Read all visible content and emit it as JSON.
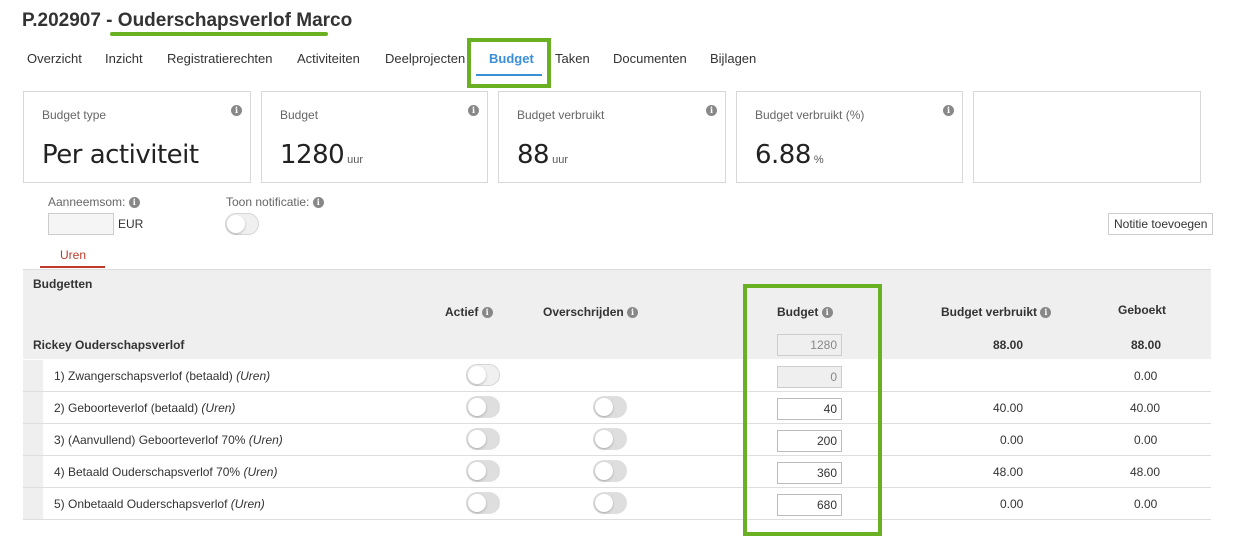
{
  "project": {
    "title": "P.202907 - Ouderschapsverlof Marco"
  },
  "tabs": [
    "Overzicht",
    "Inzicht",
    "Registratierechten",
    "Activiteiten",
    "Deelprojecten",
    "Budget",
    "Taken",
    "Documenten",
    "Bijlagen"
  ],
  "active_tab": "Budget",
  "cards": [
    {
      "label": "Budget type",
      "value": "Per activiteit",
      "unit": ""
    },
    {
      "label": "Budget",
      "value": "1280",
      "unit": "uur"
    },
    {
      "label": "Budget verbruikt",
      "value": "88",
      "unit": "uur"
    },
    {
      "label": "Budget verbruikt (%)",
      "value": "6.88",
      "unit": "%"
    }
  ],
  "fields": {
    "aanneemsom_label": "Aanneemsom:",
    "currency": "EUR",
    "toon_notificatie_label": "Toon notificatie:"
  },
  "notitie_button": "Notitie toevoegen",
  "subtab": "Uren",
  "table": {
    "section": "Budgetten",
    "headers": {
      "actief": "Actief",
      "overschrijden": "Overschrijden",
      "budget": "Budget",
      "verbruikt": "Budget verbruikt",
      "geboekt": "Geboekt"
    },
    "group": {
      "name": "Rickey Ouderschapsverlof",
      "budget": "1280",
      "verbruikt": "88.00",
      "geboekt": "88.00"
    },
    "rows": [
      {
        "name": "1) Zwangerschapsverlof (betaald)",
        "unit": "(Uren)",
        "budget": "0",
        "verbruikt": "",
        "geboekt": "0.00"
      },
      {
        "name": "2) Geboorteverlof (betaald)",
        "unit": "(Uren)",
        "budget": "40",
        "verbruikt": "40.00",
        "geboekt": "40.00"
      },
      {
        "name": "3) (Aanvullend) Geboorteverlof 70%",
        "unit": "(Uren)",
        "budget": "200",
        "verbruikt": "0.00",
        "geboekt": "0.00"
      },
      {
        "name": "4) Betaald Ouderschapsverlof 70%",
        "unit": "(Uren)",
        "budget": "360",
        "verbruikt": "48.00",
        "geboekt": "48.00"
      },
      {
        "name": "5) Onbetaald Ouderschapsverlof",
        "unit": "(Uren)",
        "budget": "680",
        "verbruikt": "0.00",
        "geboekt": "0.00"
      }
    ]
  },
  "colors": {
    "highlight": "#6ab023",
    "active_tab": "#3a8fd6",
    "subtab": "#c0392b"
  }
}
